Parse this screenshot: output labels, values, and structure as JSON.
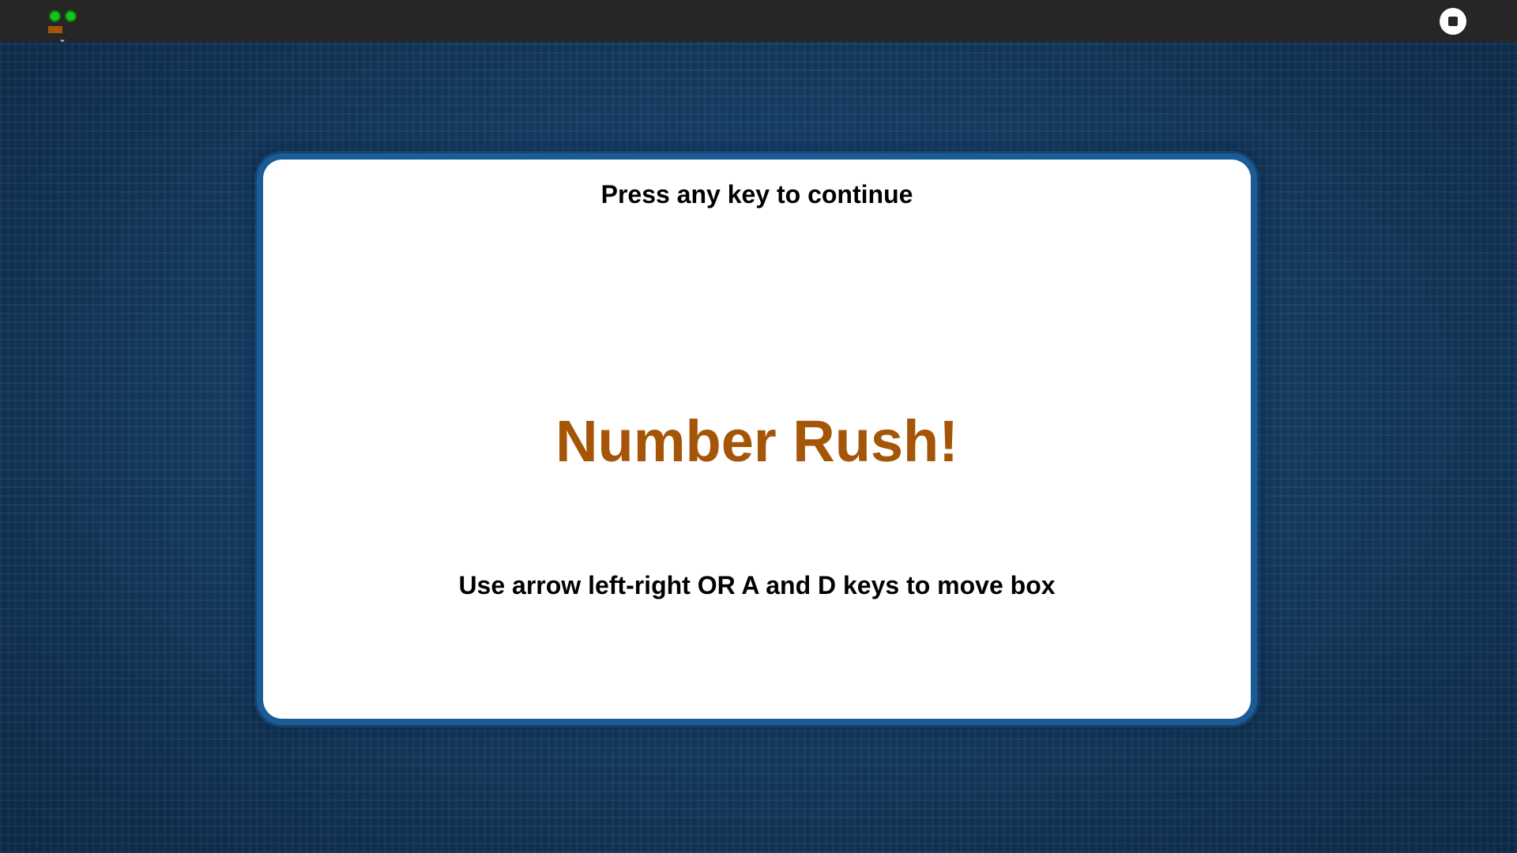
{
  "topbar": {
    "logo_icon": "robot-face-icon",
    "menu_icon": "chevron-down-icon",
    "stop_icon": "stop-icon"
  },
  "colors": {
    "topbar": "#262626",
    "background": "#143a63",
    "card_border": "#1b5c96",
    "title": "#a45507",
    "logo_eyes": "#17c417"
  },
  "game": {
    "prompt": "Press any key to continue",
    "title": "Number Rush!",
    "instructions": "Use arrow left-right OR A and D keys to move box"
  }
}
